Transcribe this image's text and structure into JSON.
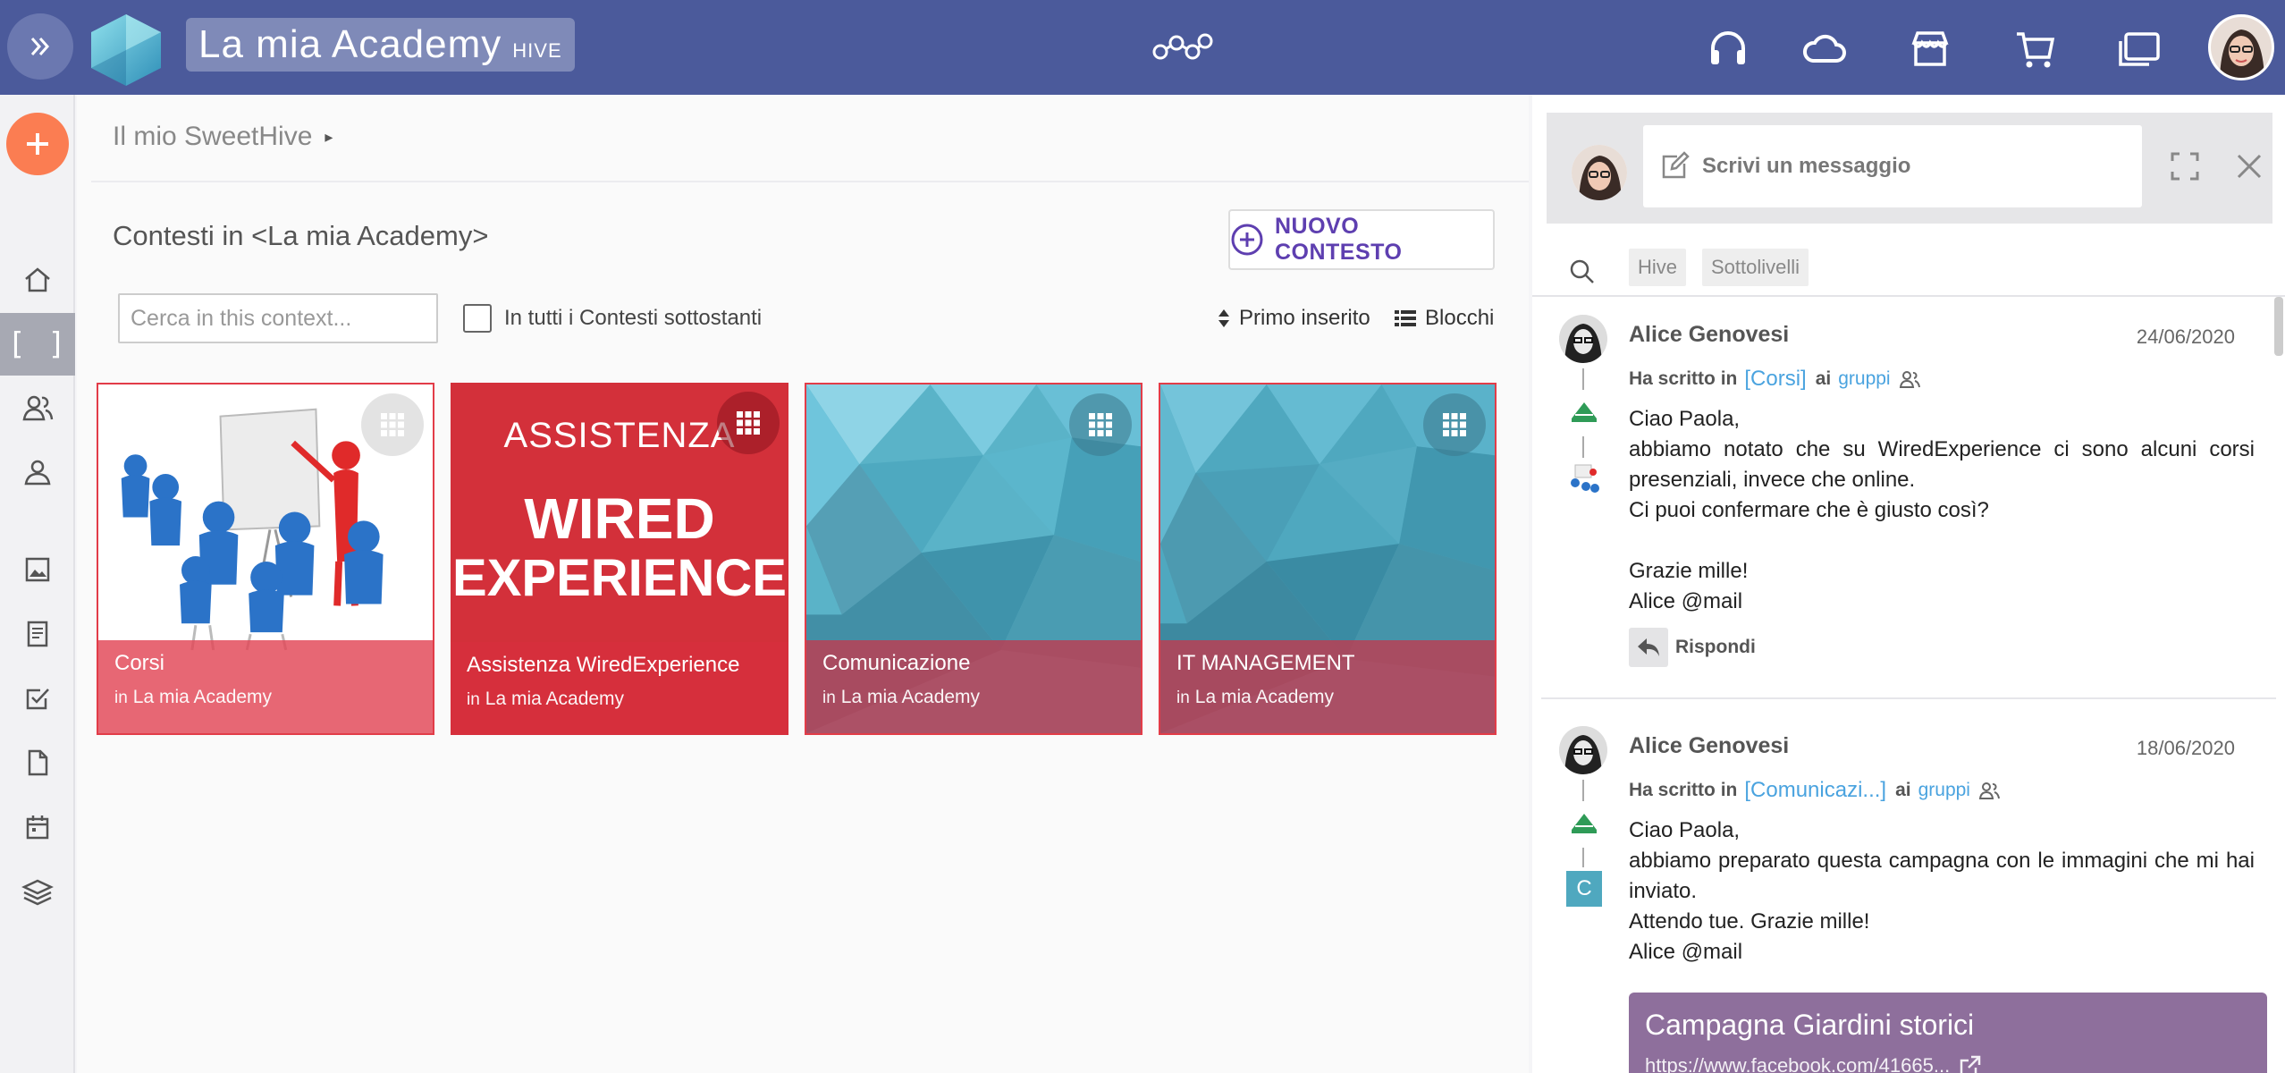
{
  "header": {
    "title": "La mia Academy",
    "title_suffix": "HIVE",
    "icons": [
      "expand-icon",
      "hive-logo",
      "network-icon",
      "headset-icon",
      "cloud-icon",
      "store-icon",
      "cart-icon",
      "chat-windows-icon",
      "user-avatar"
    ]
  },
  "sidebar": {
    "items": [
      "add",
      "home",
      "contexts",
      "groups",
      "profile",
      "gallery",
      "documents",
      "tasks",
      "files",
      "calendar",
      "layers"
    ],
    "active_label": "[ ]"
  },
  "main": {
    "breadcrumb": "Il mio SweetHive",
    "page_title": "Contesti in <La mia Academy>",
    "new_context_label": "NUOVO CONTESTO",
    "search_placeholder": "Cerca in this context...",
    "all_contexts_label": "In tutti i Contesti sottostanti",
    "sort_label": "Primo inserito",
    "view_label": "Blocchi",
    "in_label": "in",
    "cards": [
      {
        "title": "Corsi",
        "parent": "La mia Academy"
      },
      {
        "title": "Assistenza WiredExperience",
        "parent": "La mia Academy",
        "banner_top": "ASSISTENZA",
        "banner_main1": "WIRED",
        "banner_main2": "EXPERIENCE"
      },
      {
        "title": "Comunicazione",
        "parent": "La mia Academy"
      },
      {
        "title": "IT MANAGEMENT",
        "parent": "La mia Academy"
      }
    ]
  },
  "panel": {
    "compose_placeholder": "Scrivi un messaggio",
    "filters": [
      "Hive",
      "Sottolivelli"
    ],
    "posts": [
      {
        "author": "Alice Genovesi",
        "date": "24/06/2020",
        "wrote_in": "Ha scritto in",
        "context": "[Corsi]",
        "to": "ai",
        "group": "gruppi",
        "lines": [
          "Ciao Paola,",
          "abbiamo notato che su WiredExperience ci sono alcuni corsi presenziali, invece che online.",
          "Ci puoi confermare che è giusto così?",
          "",
          "Grazie mille!",
          "Alice @mail"
        ],
        "reply_label": "Rispondi"
      },
      {
        "author": "Alice Genovesi",
        "date": "18/06/2020",
        "wrote_in": "Ha scritto in",
        "context": "[Comunicazi...]",
        "to": "ai",
        "group": "gruppi",
        "badge_letter": "C",
        "lines": [
          "Ciao Paola,",
          "abbiamo preparato questa campagna con le immagini che mi hai inviato.",
          "Attendo tue. Grazie mille!",
          "Alice @mail"
        ],
        "link_title": "Campagna Giardini storici",
        "link_url": "https://www.facebook.com/41665..."
      }
    ]
  },
  "colors": {
    "topbar": "#4b5a9b",
    "accent_orange": "#fb7d52",
    "accent_purple": "#5e3fb0",
    "link_blue": "#4aa3df",
    "card_red": "#d3303a",
    "card_teal": "#4fa8bf"
  }
}
